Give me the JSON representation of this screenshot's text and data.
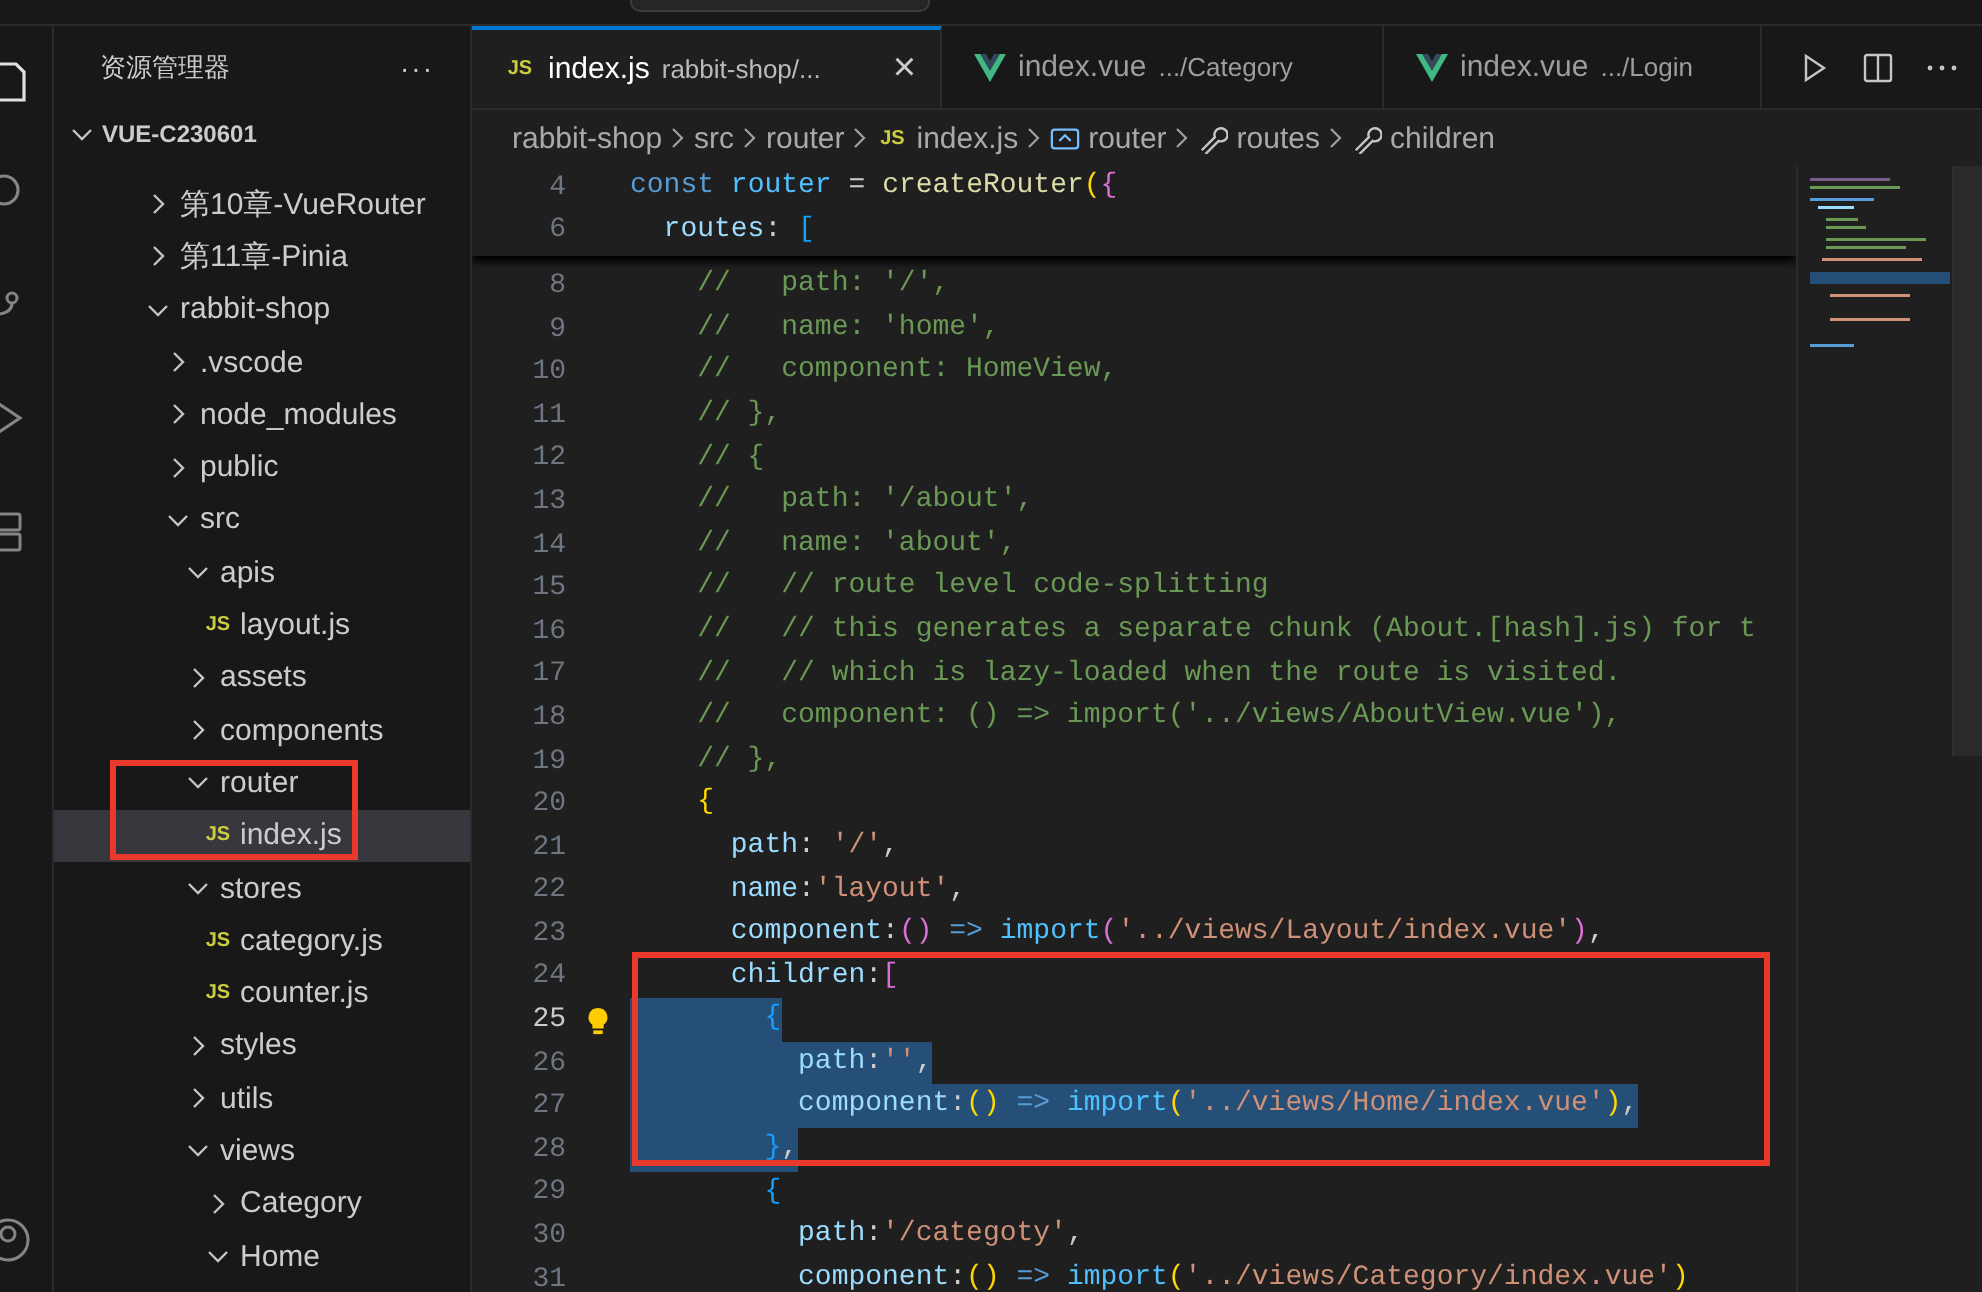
{
  "activity_bar": {
    "items": [
      {
        "kind": "files",
        "selected": true
      },
      {
        "kind": "search",
        "selected": false
      },
      {
        "kind": "source-control",
        "selected": false
      },
      {
        "kind": "run",
        "selected": false
      },
      {
        "kind": "extensions",
        "selected": false
      }
    ],
    "bottom": [
      {
        "kind": "account",
        "selected": false
      }
    ]
  },
  "sidebar": {
    "title": "资源管理器",
    "more": "···",
    "section": {
      "title": "VUE-C230601",
      "expanded": true
    },
    "tree": [
      {
        "name": "第10章-VueRouter",
        "kind": "folder",
        "expanded": false,
        "selected": false
      },
      {
        "name": "第11章-Pinia",
        "kind": "folder",
        "expanded": false,
        "selected": false
      },
      {
        "name": "rabbit-shop",
        "kind": "folder",
        "expanded": true,
        "selected": false,
        "children": [
          {
            "name": ".vscode",
            "kind": "folder",
            "expanded": false,
            "selected": false
          },
          {
            "name": "node_modules",
            "kind": "folder",
            "expanded": false,
            "selected": false
          },
          {
            "name": "public",
            "kind": "folder",
            "expanded": false,
            "selected": false
          },
          {
            "name": "src",
            "kind": "folder",
            "expanded": true,
            "selected": false,
            "children": [
              {
                "name": "apis",
                "kind": "folder",
                "expanded": true,
                "selected": false,
                "children": [
                  {
                    "name": "layout.js",
                    "kind": "file",
                    "badge": "JS",
                    "selected": false
                  }
                ]
              },
              {
                "name": "assets",
                "kind": "folder",
                "expanded": false,
                "selected": false
              },
              {
                "name": "components",
                "kind": "folder",
                "expanded": false,
                "selected": false
              },
              {
                "name": "router",
                "kind": "folder",
                "expanded": true,
                "selected": false,
                "children": [
                  {
                    "name": "index.js",
                    "kind": "file",
                    "badge": "JS",
                    "selected": true
                  }
                ]
              },
              {
                "name": "stores",
                "kind": "folder",
                "expanded": true,
                "selected": false,
                "children": [
                  {
                    "name": "category.js",
                    "kind": "file",
                    "badge": "JS",
                    "selected": false
                  },
                  {
                    "name": "counter.js",
                    "kind": "file",
                    "badge": "JS",
                    "selected": false
                  }
                ]
              },
              {
                "name": "styles",
                "kind": "folder",
                "expanded": false,
                "selected": false
              },
              {
                "name": "utils",
                "kind": "folder",
                "expanded": false,
                "selected": false
              },
              {
                "name": "views",
                "kind": "folder",
                "expanded": true,
                "selected": false,
                "children": [
                  {
                    "name": "Category",
                    "kind": "folder",
                    "expanded": false,
                    "selected": false
                  },
                  {
                    "name": "Home",
                    "kind": "folder",
                    "expanded": true,
                    "selected": false
                  }
                ]
              }
            ]
          }
        ]
      }
    ]
  },
  "tabs": [
    {
      "kind": "js",
      "badge": "JS",
      "label": "index.js",
      "description": "rabbit-shop/...",
      "close": "×",
      "selected": true
    },
    {
      "kind": "vue",
      "label": "index.vue",
      "description": ".../Category",
      "selected": false
    },
    {
      "kind": "vue",
      "label": "index.vue",
      "description": ".../Login",
      "selected": false
    }
  ],
  "breadcrumbs": [
    {
      "kind": "folder",
      "label": "rabbit-shop"
    },
    {
      "kind": "folder",
      "label": "src"
    },
    {
      "kind": "folder",
      "label": "router"
    },
    {
      "kind": "js",
      "badge": "JS",
      "label": "index.js"
    },
    {
      "kind": "symbol",
      "label": "router"
    },
    {
      "kind": "property",
      "label": "routes"
    },
    {
      "kind": "property",
      "label": "children"
    }
  ],
  "sticky_lines": [
    {
      "number": "4",
      "tokens": [
        {
          "kind": "keyword",
          "text": "const "
        },
        {
          "kind": "constant",
          "text": "router"
        },
        {
          "kind": "plain",
          "text": " = "
        },
        {
          "kind": "function",
          "text": "createRouter"
        },
        {
          "kind": "bracket1",
          "text": "("
        },
        {
          "kind": "bracket2",
          "text": "{"
        }
      ]
    },
    {
      "number": "6",
      "tokens": [
        {
          "kind": "property",
          "text": "  routes"
        },
        {
          "kind": "plain",
          "text": ": "
        },
        {
          "kind": "bracket3",
          "text": "["
        }
      ]
    }
  ],
  "code_lines": [
    {
      "number": "8",
      "active": false,
      "selected": false,
      "tokens": [
        {
          "kind": "comment",
          "text": "    //   path: '/',"
        }
      ]
    },
    {
      "number": "9",
      "active": false,
      "selected": false,
      "tokens": [
        {
          "kind": "comment",
          "text": "    //   name: 'home',"
        }
      ]
    },
    {
      "number": "10",
      "active": false,
      "selected": false,
      "tokens": [
        {
          "kind": "comment",
          "text": "    //   component: HomeView,"
        }
      ]
    },
    {
      "number": "11",
      "active": false,
      "selected": false,
      "tokens": [
        {
          "kind": "comment",
          "text": "    // },"
        }
      ]
    },
    {
      "number": "12",
      "active": false,
      "selected": false,
      "tokens": [
        {
          "kind": "comment",
          "text": "    // {"
        }
      ]
    },
    {
      "number": "13",
      "active": false,
      "selected": false,
      "tokens": [
        {
          "kind": "comment",
          "text": "    //   path: '/about',"
        }
      ]
    },
    {
      "number": "14",
      "active": false,
      "selected": false,
      "tokens": [
        {
          "kind": "comment",
          "text": "    //   name: 'about',"
        }
      ]
    },
    {
      "number": "15",
      "active": false,
      "selected": false,
      "tokens": [
        {
          "kind": "comment",
          "text": "    //   // route level code-splitting"
        }
      ]
    },
    {
      "number": "16",
      "active": false,
      "selected": false,
      "tokens": [
        {
          "kind": "comment",
          "text": "    //   // this generates a separate chunk (About.[hash].js) for t"
        }
      ]
    },
    {
      "number": "17",
      "active": false,
      "selected": false,
      "tokens": [
        {
          "kind": "comment",
          "text": "    //   // which is lazy-loaded when the route is visited."
        }
      ]
    },
    {
      "number": "18",
      "active": false,
      "selected": false,
      "tokens": [
        {
          "kind": "comment",
          "text": "    //   component: () => import('../views/AboutView.vue'),"
        }
      ]
    },
    {
      "number": "19",
      "active": false,
      "selected": false,
      "tokens": [
        {
          "kind": "comment",
          "text": "    // },"
        }
      ]
    },
    {
      "number": "20",
      "active": false,
      "selected": false,
      "tokens": [
        {
          "kind": "bracket1",
          "text": "    {"
        }
      ]
    },
    {
      "number": "21",
      "active": false,
      "selected": false,
      "tokens": [
        {
          "kind": "property",
          "text": "      path"
        },
        {
          "kind": "plain",
          "text": ": "
        },
        {
          "kind": "string",
          "text": "'/'"
        },
        {
          "kind": "plain",
          "text": ","
        }
      ]
    },
    {
      "number": "22",
      "active": false,
      "selected": false,
      "tokens": [
        {
          "kind": "property",
          "text": "      name"
        },
        {
          "kind": "plain",
          "text": ":"
        },
        {
          "kind": "string",
          "text": "'layout'"
        },
        {
          "kind": "plain",
          "text": ","
        }
      ]
    },
    {
      "number": "23",
      "active": false,
      "selected": false,
      "tokens": [
        {
          "kind": "property",
          "text": "      component"
        },
        {
          "kind": "plain",
          "text": ":"
        },
        {
          "kind": "bracket2",
          "text": "()"
        },
        {
          "kind": "keyword",
          "text": " => "
        },
        {
          "kind": "import",
          "text": "import"
        },
        {
          "kind": "bracket2",
          "text": "("
        },
        {
          "kind": "string",
          "text": "'../views/Layout/index.vue'"
        },
        {
          "kind": "bracket2",
          "text": ")"
        },
        {
          "kind": "plain",
          "text": ","
        }
      ]
    },
    {
      "number": "24",
      "active": false,
      "selected": false,
      "tokens": [
        {
          "kind": "property",
          "text": "      children"
        },
        {
          "kind": "plain",
          "text": ":"
        },
        {
          "kind": "bracket2",
          "text": "["
        }
      ]
    },
    {
      "number": "25",
      "active": true,
      "selected": true,
      "tokens": [
        {
          "kind": "bracket3",
          "text": "        {"
        }
      ]
    },
    {
      "number": "26",
      "active": false,
      "selected": true,
      "tokens": [
        {
          "kind": "property",
          "text": "          path"
        },
        {
          "kind": "plain",
          "text": ":"
        },
        {
          "kind": "string",
          "text": "''"
        },
        {
          "kind": "plain",
          "text": ","
        }
      ]
    },
    {
      "number": "27",
      "active": false,
      "selected": true,
      "tokens": [
        {
          "kind": "property",
          "text": "          component"
        },
        {
          "kind": "plain",
          "text": ":"
        },
        {
          "kind": "bracket1",
          "text": "()"
        },
        {
          "kind": "keyword",
          "text": " => "
        },
        {
          "kind": "import",
          "text": "import"
        },
        {
          "kind": "bracket1",
          "text": "("
        },
        {
          "kind": "string",
          "text": "'../views/Home/index.vue'"
        },
        {
          "kind": "bracket1",
          "text": ")"
        },
        {
          "kind": "plain",
          "text": ","
        }
      ]
    },
    {
      "number": "28",
      "active": false,
      "selected": true,
      "tokens": [
        {
          "kind": "bracket3",
          "text": "        }"
        },
        {
          "kind": "plain",
          "text": ","
        }
      ]
    },
    {
      "number": "29",
      "active": false,
      "selected": false,
      "tokens": [
        {
          "kind": "bracket3",
          "text": "        {"
        }
      ]
    },
    {
      "number": "30",
      "active": false,
      "selected": false,
      "tokens": [
        {
          "kind": "property",
          "text": "          path"
        },
        {
          "kind": "plain",
          "text": ":"
        },
        {
          "kind": "string",
          "text": "'/categoty'"
        },
        {
          "kind": "plain",
          "text": ","
        }
      ]
    },
    {
      "number": "31",
      "active": false,
      "selected": false,
      "tokens": [
        {
          "kind": "property",
          "text": "          component"
        },
        {
          "kind": "plain",
          "text": ":"
        },
        {
          "kind": "bracket1",
          "text": "()"
        },
        {
          "kind": "keyword",
          "text": " => "
        },
        {
          "kind": "import",
          "text": "import"
        },
        {
          "kind": "bracket1",
          "text": "("
        },
        {
          "kind": "string",
          "text": "'../views/Category/index.vue'"
        },
        {
          "kind": "bracket1",
          "text": ")"
        }
      ]
    }
  ]
}
